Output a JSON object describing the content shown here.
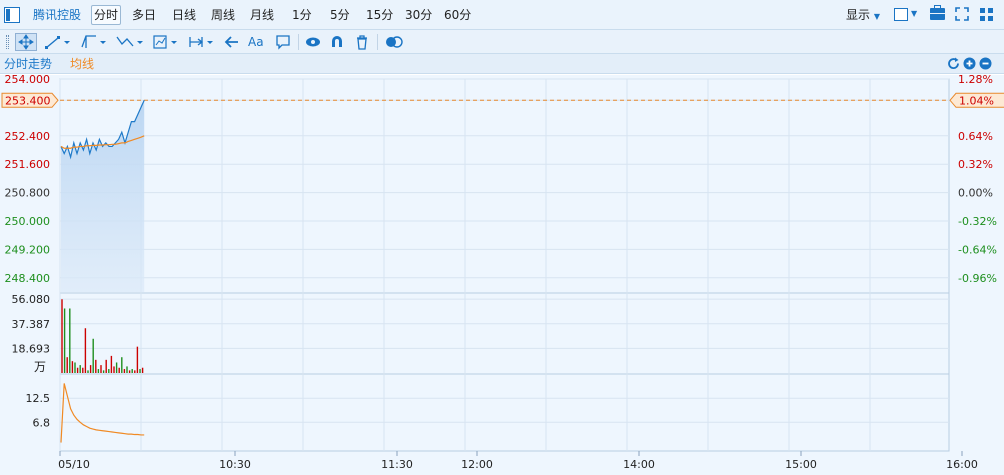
{
  "topbar": {
    "tabs": [
      "腾讯控股",
      "分时",
      "多日",
      "日线",
      "周线",
      "月线",
      "1分",
      "5分",
      "15分",
      "30分",
      "60分"
    ],
    "active_tab": "分时",
    "display_label": "显示"
  },
  "legend": {
    "line1": "分时走势",
    "line2": "均线"
  },
  "colors": {
    "price_line": "#1f7ac9",
    "avg_line": "#f08a24",
    "up": "#cc0000",
    "down": "#1e8f1e",
    "grid": "#d7e4f1",
    "ref_line": "#e8892d"
  },
  "chart_data": [
    {
      "type": "line",
      "title": "",
      "price_axis_labels": [
        "254.000",
        "253.400",
        "252.400",
        "251.600",
        "250.800",
        "250.000",
        "249.200",
        "248.400"
      ],
      "pct_axis_labels": [
        "1.28%",
        "1.04%",
        "0.64%",
        "0.32%",
        "0.00%",
        "-0.32%",
        "-0.64%",
        "-0.96%"
      ],
      "ylim": [
        248.0,
        254.0
      ],
      "current_price": "253.400",
      "current_pct": "1.04%",
      "series": [
        {
          "name": "分时走势",
          "values": [
            252.1,
            251.9,
            252.1,
            251.8,
            252.2,
            251.9,
            252.2,
            252.0,
            252.3,
            251.9,
            252.2,
            252.0,
            252.3,
            252.1,
            252.2,
            252.1,
            252.1,
            252.2,
            252.3,
            252.5,
            252.2,
            252.5,
            252.8,
            252.8,
            253.0,
            253.2,
            253.4
          ]
        },
        {
          "name": "均线",
          "values": [
            252.1,
            252.05,
            252.05,
            252.05,
            252.08,
            252.08,
            252.1,
            252.1,
            252.12,
            252.12,
            252.13,
            252.13,
            252.14,
            252.14,
            252.15,
            252.15,
            252.16,
            252.16,
            252.18,
            252.2,
            252.2,
            252.24,
            252.27,
            252.3,
            252.33,
            252.36,
            252.4
          ]
        }
      ]
    },
    {
      "type": "bar",
      "title": "",
      "y_axis_labels": [
        "56.080",
        "37.387",
        "18.693"
      ],
      "unit_label": "万",
      "ylim": [
        0,
        60
      ],
      "values": [
        56,
        49,
        12,
        49,
        9,
        8,
        4,
        6,
        4,
        34,
        2,
        6,
        26,
        10,
        3,
        6,
        2,
        10,
        3,
        13,
        5,
        8,
        4,
        12,
        3,
        5,
        2,
        3,
        2,
        20,
        3,
        4
      ],
      "up_flags": [
        1,
        0,
        1,
        0,
        1,
        0,
        1,
        0,
        1,
        1,
        0,
        1,
        0,
        1,
        0,
        1,
        0,
        1,
        0,
        1,
        1,
        0,
        1,
        0,
        1,
        0,
        1,
        0,
        1,
        1,
        0,
        1
      ]
    },
    {
      "type": "line",
      "title": "",
      "y_axis_labels": [
        "12.5",
        "6.8"
      ],
      "ylim": [
        0,
        18
      ],
      "values": [
        2,
        16,
        13,
        10,
        8.5,
        7.5,
        6.8,
        6.2,
        5.8,
        5.4,
        5.2,
        5,
        4.9,
        4.8,
        4.7,
        4.6,
        4.5,
        4.4,
        4.3,
        4.2,
        4.1,
        4.0,
        4.0,
        3.9,
        3.9,
        3.8,
        3.8
      ]
    }
  ],
  "x_axis_labels": [
    "05/10",
    "10:30",
    "11:30",
    "12:00",
    "14:00",
    "15:00",
    "16:00"
  ]
}
